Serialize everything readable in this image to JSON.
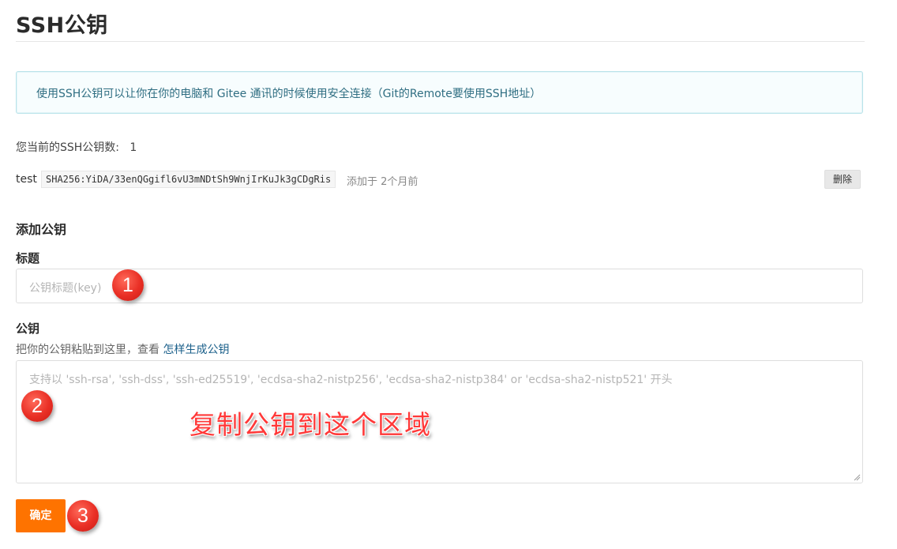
{
  "page_title": "SSH公钥",
  "info_banner": "使用SSH公钥可以让你在你的电脑和 Gitee 通讯的时候使用安全连接（Git的Remote要使用SSH地址）",
  "key_count": {
    "label": "您当前的SSH公钥数:",
    "value": "1"
  },
  "keys": [
    {
      "name": "test",
      "fingerprint": "SHA256:YiDA/33enQGgifl6vU3mNDtSh9WnjIrKuJk3gCDgRis",
      "added": "添加于 2个月前",
      "delete_label": "删除"
    }
  ],
  "add_key": {
    "section_title": "添加公钥",
    "title_label": "标题",
    "title_placeholder": "公钥标题(key)",
    "key_label": "公钥",
    "key_hint": "把你的公钥粘贴到这里，查看",
    "key_hint_link": "怎样生成公钥",
    "key_placeholder": "支持以 'ssh-rsa', 'ssh-dss', 'ssh-ed25519', 'ecdsa-sha2-nistp256', 'ecdsa-sha2-nistp384' or 'ecdsa-sha2-nistp521' 开头",
    "submit_label": "确定"
  },
  "annotations": {
    "badge_1": "1",
    "badge_2": "2",
    "badge_3": "3",
    "caption": "复制公钥到这个区域"
  },
  "colors": {
    "accent": "#fe7300",
    "info_text": "#2f6e82",
    "badge": "#e92f25",
    "link": "#1a5f8a"
  }
}
